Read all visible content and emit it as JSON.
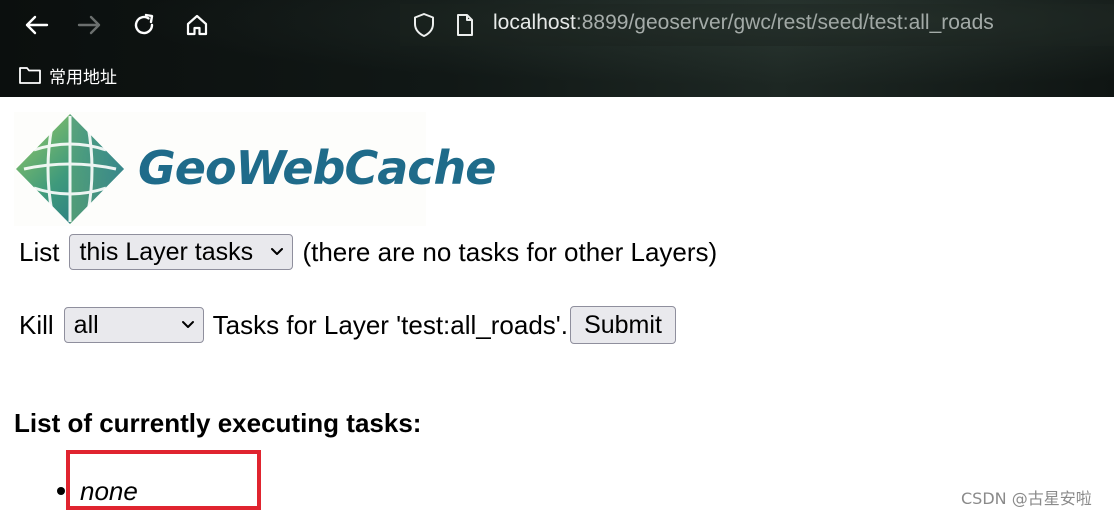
{
  "browser": {
    "url_host": "localhost",
    "url_rest": ":8899/geoserver/gwc/rest/seed/test:all_roads",
    "bookmark_label": "常用地址",
    "icons": [
      "back-arrow-icon",
      "forward-arrow-icon",
      "reload-icon",
      "home-icon",
      "shield-icon",
      "page-icon",
      "folder-icon"
    ]
  },
  "logo": {
    "text": "GeoWebCache"
  },
  "list_row": {
    "label": "List",
    "select_value": "this Layer tasks",
    "note": "(there are no tasks for other Layers)"
  },
  "kill_row": {
    "label": "Kill",
    "select_value": "all",
    "text": "Tasks for Layer 'test:all_roads'.",
    "submit_label": "Submit"
  },
  "tasks": {
    "heading": "List of currently executing tasks:",
    "items": [
      "none"
    ]
  },
  "watermark": "CSDN @古星安啦",
  "colors": {
    "logo_text": "#1f6b8a",
    "highlight_border": "#e0242f"
  }
}
